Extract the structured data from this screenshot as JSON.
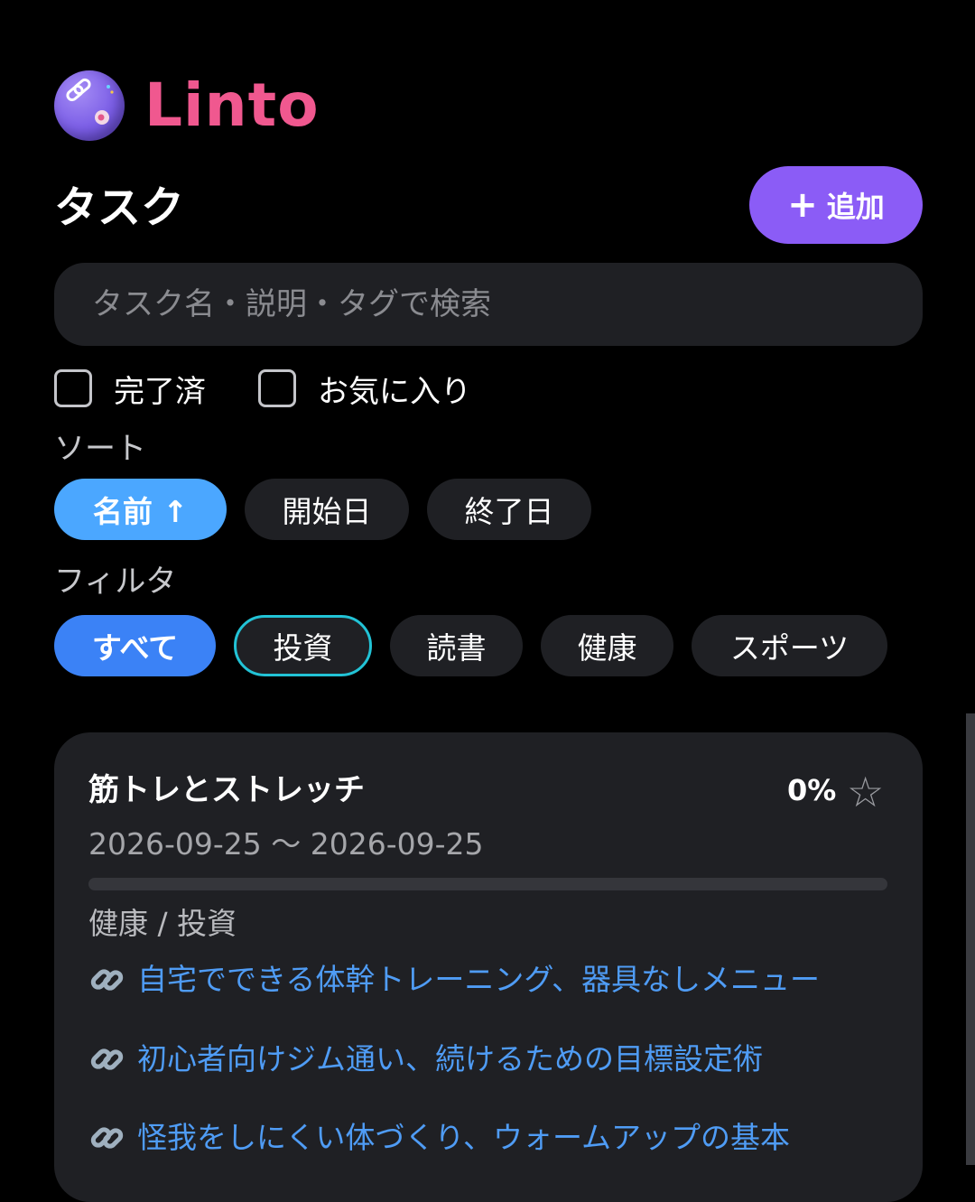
{
  "brand": {
    "name": "Linto"
  },
  "header": {
    "title": "タスク",
    "add_label": "追加",
    "add_icon": "plus-icon"
  },
  "search": {
    "placeholder": "タスク名・説明・タグで検索",
    "value": ""
  },
  "checkboxes": [
    {
      "label": "完了済",
      "checked": false
    },
    {
      "label": "お気に入り",
      "checked": false
    }
  ],
  "sort": {
    "label": "ソート",
    "options": [
      {
        "label": "名前 ↑",
        "active": true
      },
      {
        "label": "開始日",
        "active": false
      },
      {
        "label": "終了日",
        "active": false
      }
    ]
  },
  "filter": {
    "label": "フィルタ",
    "options": [
      {
        "label": "すべて",
        "active": true
      },
      {
        "label": "投資",
        "active": false,
        "focused": true
      },
      {
        "label": "読書",
        "active": false
      },
      {
        "label": "健康",
        "active": false
      },
      {
        "label": "スポーツ",
        "active": false
      }
    ]
  },
  "tasks": [
    {
      "title": "筋トレとストレッチ",
      "progress_text": "0%",
      "progress": 0,
      "favorite": false,
      "favorite_icon": "star-outline-icon",
      "dates": "2026-09-25 〜 2026-09-25",
      "tags": "健康 / 投資",
      "links": [
        "自宅でできる体幹トレーニング、器具なしメニュー",
        "初心者向けジム通い、続けるための目標設定術",
        "怪我をしにくい体づくり、ウォームアップの基本"
      ]
    }
  ],
  "colors": {
    "background": "#000000",
    "surface": "#1f2024",
    "brand": "#f0588f",
    "add_button": "#8b5cf6",
    "sort_active": "#4ba7ff",
    "filter_active": "#3b82f6",
    "focus_ring": "#22c3d6",
    "link": "#4f9cf5"
  }
}
